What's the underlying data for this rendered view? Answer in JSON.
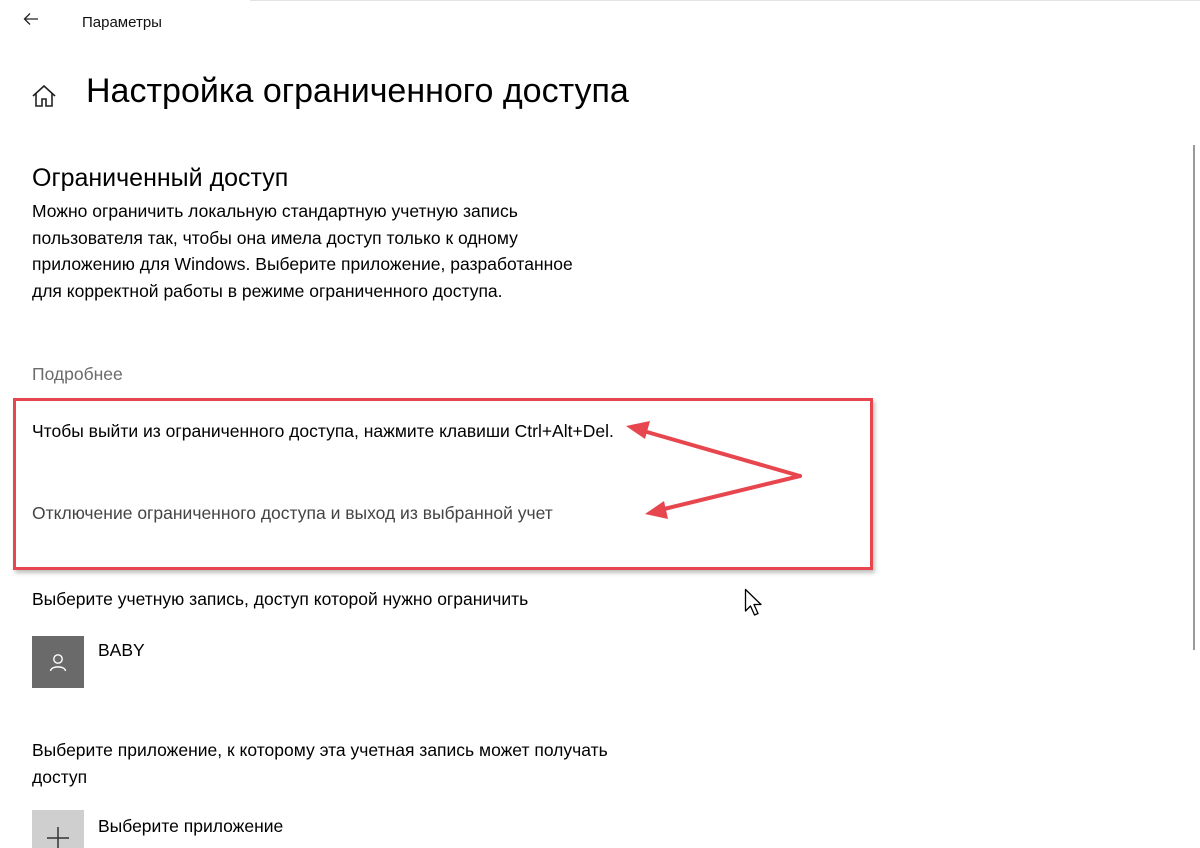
{
  "titlebar": {
    "app_title": "Параметры",
    "back_icon": "back-arrow-icon"
  },
  "header": {
    "home_icon": "home-icon",
    "page_title": "Настройка ограниченного доступа"
  },
  "section": {
    "title": "Ограниченный доступ",
    "description": "Можно ограничить локальную стандартную учетную запись пользователя так, чтобы она имела доступ только к одному приложению для Windows. Выберите приложение, разработанное для корректной работы в режиме ограниченного доступа.",
    "more_link": "Подробнее"
  },
  "highlight": {
    "exit_hint": "Чтобы выйти из ограниченного доступа, нажмите клавиши Ctrl+Alt+Del.",
    "disable_link": "Отключение ограниченного доступа и выход из выбранной учет",
    "color": "#e8464f"
  },
  "account": {
    "label": "Выберите учетную запись, доступ которой нужно ограничить",
    "name": "BABY",
    "icon": "user-icon"
  },
  "app": {
    "label": "Выберите приложение, к которому эта учетная запись может получать доступ",
    "choose_label": "Выберите приложение",
    "icon": "plus-icon"
  }
}
